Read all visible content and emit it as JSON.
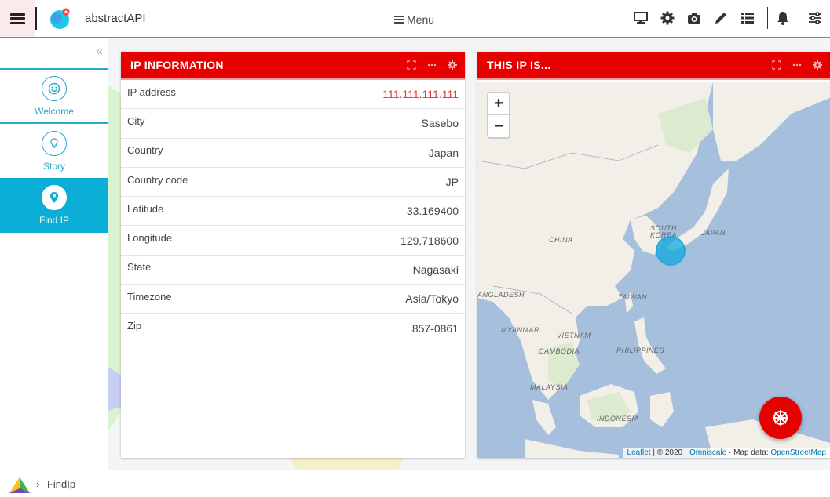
{
  "header": {
    "app_title": "abstractAPI",
    "menu_label": "Menu",
    "icons": [
      "monitor-icon",
      "gear-icon",
      "camera-icon",
      "pencil-icon",
      "list-icon",
      "bell-icon",
      "sliders-icon"
    ]
  },
  "sidebar": {
    "collapse_glyph": "«",
    "items": [
      {
        "label": "Welcome",
        "icon": "smile-icon",
        "active": false
      },
      {
        "label": "Story",
        "icon": "bulb-icon",
        "active": false
      },
      {
        "label": "Find IP",
        "icon": "location-pin-icon",
        "active": true
      }
    ]
  },
  "ip_card": {
    "title": "IP INFORMATION",
    "rows": [
      {
        "label": "IP address",
        "value": "111.111.111.111"
      },
      {
        "label": "City",
        "value": "Sasebo"
      },
      {
        "label": "Country",
        "value": "Japan"
      },
      {
        "label": "Country code",
        "value": "JP"
      },
      {
        "label": "Latitude",
        "value": "33.169400"
      },
      {
        "label": "Longitude",
        "value": "129.718600"
      },
      {
        "label": "State",
        "value": "Nagasaki"
      },
      {
        "label": "Timezone",
        "value": "Asia/Tokyo"
      },
      {
        "label": "Zip",
        "value": "857-0861"
      }
    ]
  },
  "map_card": {
    "title": "THIS IP IS...",
    "zoom_in": "+",
    "zoom_out": "−",
    "labels": {
      "china": "CHINA",
      "south_korea_1": "SOUTH",
      "south_korea_2": "KOREA",
      "japan": "JAPAN",
      "taiwan": "TAIWAN",
      "bangladesh": "ANGLADESH",
      "myanmar": "MYANMAR",
      "vietnam": "VIETNAM",
      "cambodia": "CAMBODIA",
      "philippines": "PHILIPPINES",
      "malaysia": "MALAYSIA",
      "indonesia": "INDONESIA"
    },
    "attribution": {
      "leaflet": "Leaflet",
      "sep1": " | © 2020 · ",
      "omniscale": "Omniscale",
      "sep2": " · Map data: ",
      "osm": "OpenStreetMap"
    }
  },
  "footer": {
    "chevron": "›",
    "breadcrumb": "FindIp"
  },
  "colors": {
    "accent": "#29a9c9",
    "card_header": "#e60000",
    "active_sidebar": "#0aaed6",
    "ip_value": "#e53a3a",
    "water": "#a5bfdd"
  }
}
